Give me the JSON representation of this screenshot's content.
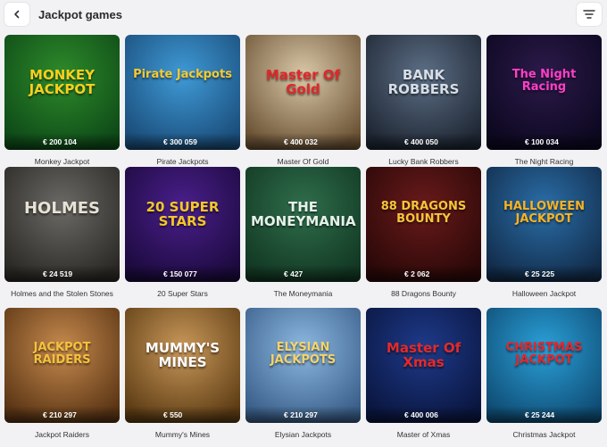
{
  "header": {
    "title": "Jackpot games",
    "back_icon": "chevron-left-icon",
    "filter_icon": "filter-lines-icon"
  },
  "games": [
    {
      "name": "Monkey Jackpot",
      "jackpot": "€ 200 104",
      "logo": "MONKEY JACKPOT",
      "colors": [
        "#2e8b2a",
        "#0e4a18"
      ],
      "logo_color": "#f5d020"
    },
    {
      "name": "Pirate Jackpots",
      "jackpot": "€ 300 059",
      "logo": "Pirate Jackpots",
      "colors": [
        "#3f9ad6",
        "#1a4d7a"
      ],
      "logo_color": "#f7c933"
    },
    {
      "name": "Master Of Gold",
      "jackpot": "€ 400 032",
      "logo": "Master Of Gold",
      "colors": [
        "#d9c9a8",
        "#6b5234"
      ],
      "logo_color": "#e0272a"
    },
    {
      "name": "Lucky Bank Robbers",
      "jackpot": "€ 400 050",
      "logo": "BANK ROBBERS",
      "colors": [
        "#5d6f86",
        "#1e2633"
      ],
      "logo_color": "#d6dde6"
    },
    {
      "name": "The Night Racing",
      "jackpot": "€ 100 034",
      "logo": "The Night Racing",
      "colors": [
        "#2c1a4a",
        "#0c0820"
      ],
      "logo_color": "#ff3fc8"
    },
    {
      "name": "Holmes and the Stolen Stones",
      "jackpot": "€ 24 519",
      "logo": "HOLMES",
      "colors": [
        "#6c6a66",
        "#2b2925"
      ],
      "logo_color": "#e8e2d6"
    },
    {
      "name": "20 Super Stars",
      "jackpot": "€ 150 077",
      "logo": "20 SUPER STARS",
      "colors": [
        "#4a1f8c",
        "#1c0a3e"
      ],
      "logo_color": "#f3c62a"
    },
    {
      "name": "The Moneymania",
      "jackpot": "€ 427",
      "logo": "THE MONEYMANIA",
      "colors": [
        "#2f6e4c",
        "#123823"
      ],
      "logo_color": "#e6f2e9"
    },
    {
      "name": "88 Dragons Bounty",
      "jackpot": "€ 2 062",
      "logo": "88 DRAGONS BOUNTY",
      "colors": [
        "#6a1a1a",
        "#2a0808"
      ],
      "logo_color": "#f5c53a"
    },
    {
      "name": "Halloween Jackpot",
      "jackpot": "€ 25 225",
      "logo": "HALLOWEEN JACKPOT",
      "colors": [
        "#2a6ea8",
        "#122c4a"
      ],
      "logo_color": "#f7b324"
    },
    {
      "name": "Jackpot Raiders",
      "jackpot": "€ 210 297",
      "logo": "JACKPOT RAIDERS",
      "colors": [
        "#c78a4e",
        "#5a3514"
      ],
      "logo_color": "#f4c23b"
    },
    {
      "name": "Mummy's Mines",
      "jackpot": "€ 550",
      "logo": "MUMMY'S MINES",
      "colors": [
        "#c9985a",
        "#5e3d14"
      ],
      "logo_color": "#ffffff"
    },
    {
      "name": "Elysian Jackpots",
      "jackpot": "€ 210 297",
      "logo": "ELYSIAN JACKPOTS",
      "colors": [
        "#8cb8e0",
        "#3a5f8a"
      ],
      "logo_color": "#f5d36a"
    },
    {
      "name": "Master of Xmas",
      "jackpot": "€ 400 006",
      "logo": "Master Of Xmas",
      "colors": [
        "#1e3a8a",
        "#0a1640"
      ],
      "logo_color": "#e32a2a"
    },
    {
      "name": "Christmas Jackpot",
      "jackpot": "€ 25 244",
      "logo": "CHRISTMAS JACKPOT",
      "colors": [
        "#2aa0d8",
        "#0f4c74"
      ],
      "logo_color": "#e7262b"
    }
  ]
}
